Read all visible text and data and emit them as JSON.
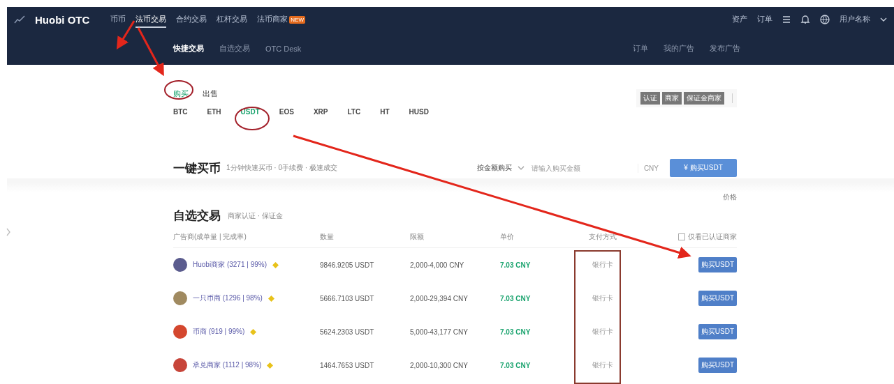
{
  "header": {
    "logo": "Huobi OTC",
    "nav": [
      {
        "label": "币币",
        "selected": false
      },
      {
        "label": "法币交易",
        "selected": true
      },
      {
        "label": "合约交易",
        "selected": false
      },
      {
        "label": "杠杆交易",
        "selected": false
      },
      {
        "label": "法币商家",
        "selected": false,
        "badge": "NEW"
      }
    ],
    "right": [
      "资产",
      "订单"
    ],
    "user": "用户名称",
    "subnav": [
      {
        "label": "快捷交易",
        "selected": true
      },
      {
        "label": "自选交易",
        "selected": false
      },
      {
        "label": "OTC Desk",
        "selected": false
      }
    ],
    "subnav_right": [
      "订单",
      "我的广告",
      "发布广告"
    ]
  },
  "trade_tabs": [
    {
      "label": "购买",
      "selected": true
    },
    {
      "label": "出售",
      "selected": false
    }
  ],
  "coins": [
    {
      "label": "BTC",
      "selected": false
    },
    {
      "label": "ETH",
      "selected": false
    },
    {
      "label": "USDT",
      "selected": true
    },
    {
      "label": "EOS",
      "selected": false
    },
    {
      "label": "XRP",
      "selected": false
    },
    {
      "label": "LTC",
      "selected": false
    },
    {
      "label": "HT",
      "selected": false
    },
    {
      "label": "HUSD",
      "selected": false
    }
  ],
  "tags": [
    "认证",
    "商家",
    "保证金商家"
  ],
  "quick": {
    "title": "一键买币",
    "subtitle": "1分钟快速买币 · 0手续费 · 极速成交",
    "mode": "按金额购买",
    "placeholder": "请输入购买金额",
    "unit": "CNY",
    "button": "¥ 购买USDT"
  },
  "market": {
    "title": "自选交易",
    "subtitle": "商家认证 · 保证金",
    "sort": "价格",
    "columns": [
      "广告商(成单量 | 完成率)",
      "数量",
      "限额",
      "单价",
      "支付方式"
    ],
    "filter": "仅看已认证商家",
    "rows": [
      {
        "color": "#5b5c8e",
        "name": "Huobi商家 (3271 | 99%)",
        "amount": "9846.9205 USDT",
        "limit": "2,000-4,000 CNY",
        "price": "7.03 CNY",
        "pay": "银行卡",
        "button": "购买USDT"
      },
      {
        "color": "#a08a60",
        "name": "一只币商 (1296 | 98%)",
        "amount": "5666.7103 USDT",
        "limit": "2,000-29,394 CNY",
        "price": "7.03 CNY",
        "pay": "银行卡",
        "button": "购买USDT"
      },
      {
        "color": "#d4472e",
        "name": "币商 (919 | 99%)",
        "amount": "5624.2303 USDT",
        "limit": "5,000-43,177 CNY",
        "price": "7.03 CNY",
        "pay": "银行卡",
        "button": "购买USDT"
      },
      {
        "color": "#c7453a",
        "name": "承兑商家 (1112 | 98%)",
        "amount": "1464.7653 USDT",
        "limit": "2,000-10,300 CNY",
        "price": "7.03 CNY",
        "pay": "银行卡",
        "button": "购买USDT"
      }
    ]
  }
}
